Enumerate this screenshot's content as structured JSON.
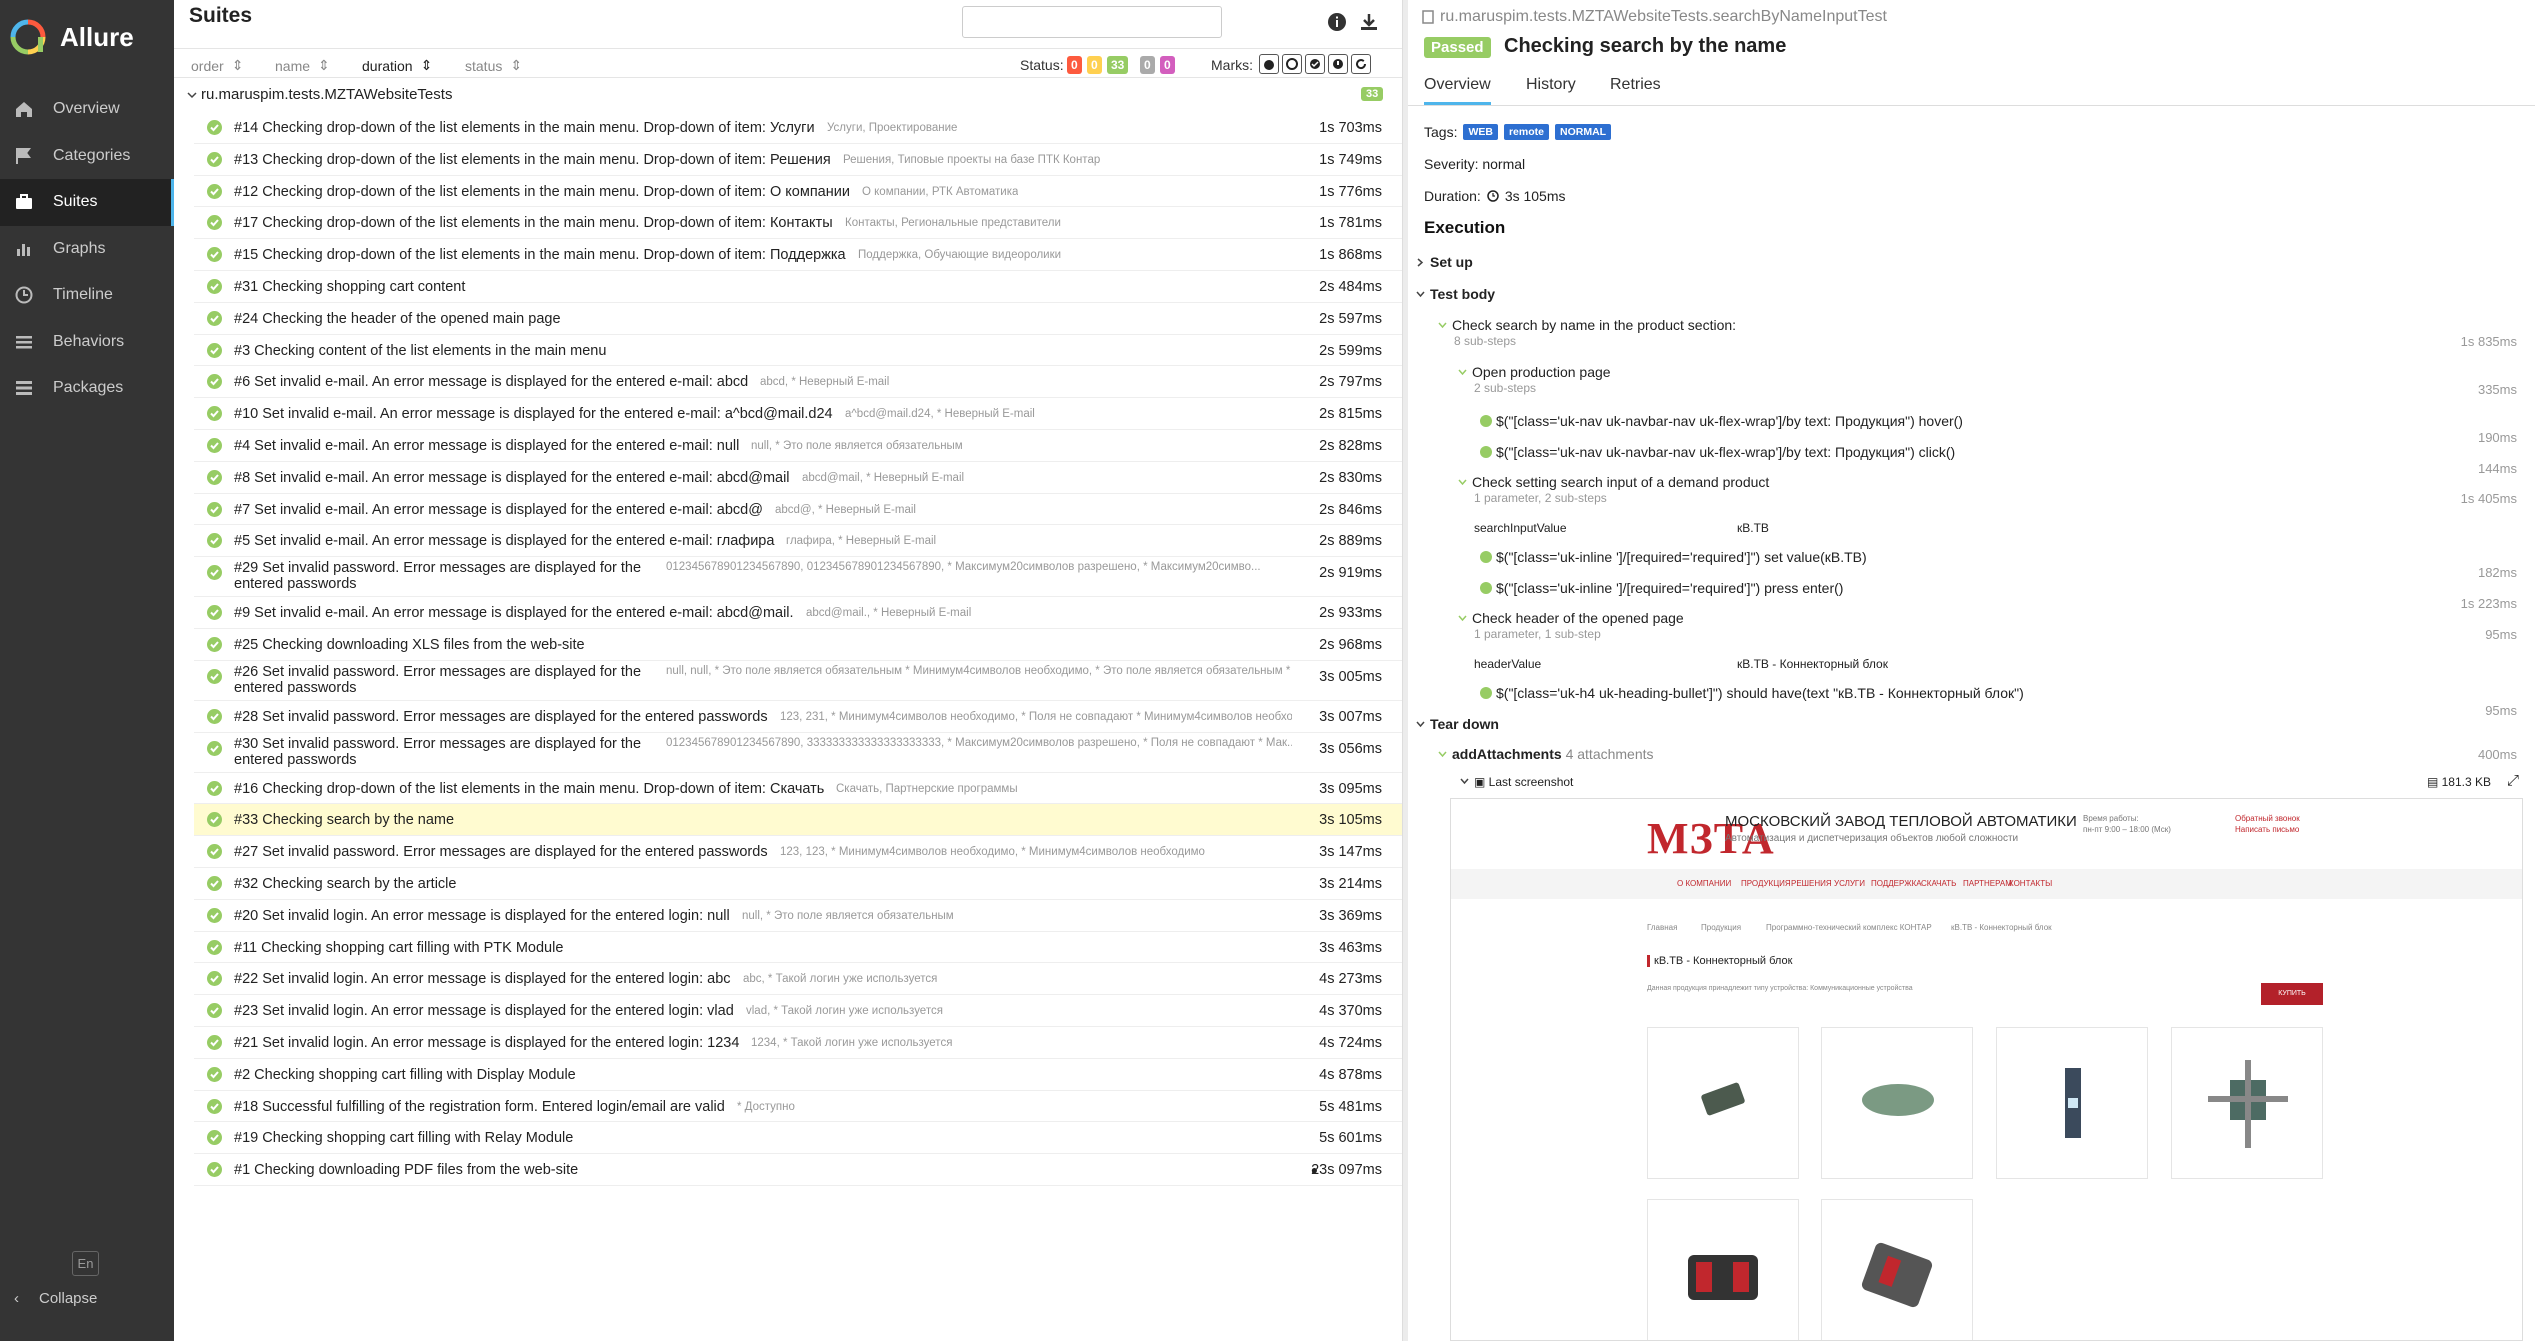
{
  "app": {
    "name": "Allure"
  },
  "sidebar": {
    "items": [
      {
        "label": "Overview",
        "icon": "home-icon"
      },
      {
        "label": "Categories",
        "icon": "flag-icon"
      },
      {
        "label": "Suites",
        "icon": "briefcase-icon",
        "active": true
      },
      {
        "label": "Graphs",
        "icon": "bar-chart-icon"
      },
      {
        "label": "Timeline",
        "icon": "clock-icon"
      },
      {
        "label": "Behaviors",
        "icon": "list-icon"
      },
      {
        "label": "Packages",
        "icon": "packages-icon"
      }
    ],
    "lang": "En",
    "collapse": "Collapse"
  },
  "suites": {
    "title": "Suites",
    "search_placeholder": "",
    "sort": {
      "order": "order",
      "name": "name",
      "duration": "duration",
      "status": "status"
    },
    "status_label": "Status:",
    "status_counts": [
      {
        "value": "0",
        "color": "#fd5a3e"
      },
      {
        "value": "0",
        "color": "#ffd050"
      },
      {
        "value": "33",
        "color": "#97cc64"
      },
      {
        "value": "0",
        "color": "#aaaaaa"
      },
      {
        "value": "0",
        "color": "#d35ebe"
      }
    ],
    "marks_label": "Marks:",
    "group": {
      "name": "ru.maruspim.tests.MZTAWebsiteTests",
      "count": "33"
    },
    "tests": [
      {
        "num": "#14",
        "name": "Checking drop-down of the list elements in the main menu. Drop-down of item: Услуги",
        "params": "Услуги, Проектирование",
        "duration": "1s 703ms"
      },
      {
        "num": "#13",
        "name": "Checking drop-down of the list elements in the main menu. Drop-down of item: Решения",
        "params": "Решения, Типовые проекты на базе ПТК Контар",
        "duration": "1s 749ms"
      },
      {
        "num": "#12",
        "name": "Checking drop-down of the list elements in the main menu. Drop-down of item: О компании",
        "params": "О компании, РТК Автоматика",
        "duration": "1s 776ms"
      },
      {
        "num": "#17",
        "name": "Checking drop-down of the list elements in the main menu. Drop-down of item: Контакты",
        "params": "Контакты, Региональные представители",
        "duration": "1s 781ms"
      },
      {
        "num": "#15",
        "name": "Checking drop-down of the list elements in the main menu. Drop-down of item: Поддержка",
        "params": "Поддержка, Обучающие видеоролики",
        "duration": "1s 868ms"
      },
      {
        "num": "#31",
        "name": "Checking shopping cart content",
        "params": "",
        "duration": "2s 484ms"
      },
      {
        "num": "#24",
        "name": "Checking the header of the opened main page",
        "params": "",
        "duration": "2s 597ms"
      },
      {
        "num": "#3",
        "name": "Checking content of the list elements in the main menu",
        "params": "",
        "duration": "2s 599ms"
      },
      {
        "num": "#6",
        "name": "Set invalid e-mail. An error message is displayed for the entered e-mail: abcd",
        "params": "abcd, * Неверный E-mail",
        "duration": "2s 797ms"
      },
      {
        "num": "#10",
        "name": "Set invalid e-mail. An error message is displayed for the entered e-mail: a^bcd@mail.d24",
        "params": "a^bcd@mail.d24, * Неверный E-mail",
        "duration": "2s 815ms"
      },
      {
        "num": "#4",
        "name": "Set invalid e-mail. An error message is displayed for the entered e-mail: null",
        "params": "null, * Это поле является обязательным",
        "duration": "2s 828ms"
      },
      {
        "num": "#8",
        "name": "Set invalid e-mail. An error message is displayed for the entered e-mail: abcd@mail",
        "params": "abcd@mail, * Неверный E-mail",
        "duration": "2s 830ms"
      },
      {
        "num": "#7",
        "name": "Set invalid e-mail. An error message is displayed for the entered e-mail: abcd@",
        "params": "abcd@, * Неверный E-mail",
        "duration": "2s 846ms"
      },
      {
        "num": "#5",
        "name": "Set invalid e-mail. An error message is displayed for the entered e-mail: глафира",
        "params": "глафира, * Неверный E-mail",
        "duration": "2s 889ms"
      },
      {
        "num": "#29",
        "name": "Set invalid password. Error messages are displayed for the entered passwords",
        "params": "01234567890123456789​0, 01234567890123456789​0, * Максимум20символов разрешено, * Максимум20симво...",
        "duration": "2s 919ms",
        "two": true
      },
      {
        "num": "#9",
        "name": "Set invalid e-mail. An error message is displayed for the entered e-mail: abcd@mail.",
        "params": "abcd@mail., * Неверный E-mail",
        "duration": "2s 933ms"
      },
      {
        "num": "#25",
        "name": "Checking downloading XLS files from the web-site",
        "params": "",
        "duration": "2s 968ms"
      },
      {
        "num": "#26",
        "name": "Set invalid password. Error messages are displayed for the entered passwords",
        "params": "null, null, * Это поле является обязательным * Минимум4символов необходимо, * Это поле является обязательным * ...",
        "duration": "3s 005ms",
        "two": true
      },
      {
        "num": "#28",
        "name": "Set invalid password. Error messages are displayed for the entered passwords",
        "params": "123, 231, * Минимум4символов необходимо, * Поля не совпадают * Минимум4символов необходимо",
        "duration": "3s 007ms"
      },
      {
        "num": "#30",
        "name": "Set invalid password. Error messages are displayed for the entered passwords",
        "params": "01234567890123456789​0, 3333333333333333333​33, * Максимум20символов разрешено, * Поля не совпадают * Мак...",
        "duration": "3s 056ms",
        "two": true
      },
      {
        "num": "#16",
        "name": "Checking drop-down of the list elements in the main menu. Drop-down of item: Скачать",
        "params": "Скачать, Партнерские программы",
        "duration": "3s 095ms"
      },
      {
        "num": "#33",
        "name": "Checking search by the name",
        "params": "",
        "duration": "3s 105ms",
        "selected": true
      },
      {
        "num": "#27",
        "name": "Set invalid password. Error messages are displayed for the entered passwords",
        "params": "123, 123, * Минимум4символов необходимо, * Минимум4символов необходимо",
        "duration": "3s 147ms"
      },
      {
        "num": "#32",
        "name": "Checking search by the article",
        "params": "",
        "duration": "3s 214ms"
      },
      {
        "num": "#20",
        "name": "Set invalid login. An error message is displayed for the entered login: null",
        "params": "null, * Это поле является обязательным",
        "duration": "3s 369ms"
      },
      {
        "num": "#11",
        "name": "Checking shopping cart filling with PTK Module",
        "params": "",
        "duration": "3s 463ms"
      },
      {
        "num": "#22",
        "name": "Set invalid login. An error message is displayed for the entered login: abc",
        "params": "abc, * Такой логин уже используется",
        "duration": "4s 273ms"
      },
      {
        "num": "#23",
        "name": "Set invalid login. An error message is displayed for the entered login: vlad",
        "params": "vlad, * Такой логин уже используется",
        "duration": "4s 370ms"
      },
      {
        "num": "#21",
        "name": "Set invalid login. An error message is displayed for the entered login: 1234",
        "params": "1234, * Такой логин уже используется",
        "duration": "4s 724ms"
      },
      {
        "num": "#2",
        "name": "Checking shopping cart filling with Display Module",
        "params": "",
        "duration": "4s 878ms"
      },
      {
        "num": "#18",
        "name": "Successful fulfilling of the registration form. Entered login/email are valid",
        "params": "* Доступно",
        "duration": "5s 481ms"
      },
      {
        "num": "#19",
        "name": "Checking shopping cart filling with Relay Module",
        "params": "",
        "duration": "5s 601ms"
      },
      {
        "num": "#1",
        "name": "Checking downloading PDF files from the web-site",
        "params": "",
        "duration": "23s 097ms",
        "marked": true
      }
    ]
  },
  "detail": {
    "path": "ru.maruspim.tests.MZTAWebsiteTests.searchByNameInputTest",
    "status": "Passed",
    "title": "Checking search by the name",
    "tabs": [
      "Overview",
      "History",
      "Retries"
    ],
    "tags_label": "Tags:",
    "tags": [
      "WEB",
      "remote",
      "NORMAL"
    ],
    "severity": "Severity: normal",
    "duration_label": "Duration:",
    "duration": "3s 105ms",
    "execution": "Execution",
    "setup": "Set up",
    "test_body": "Test body",
    "s1": {
      "title": "Check search by name in the product section:",
      "sub": "8 sub-steps",
      "dur": "1s 835ms"
    },
    "s1a": {
      "title": "Open production page",
      "sub": "2 sub-steps",
      "dur": "335ms"
    },
    "s1a1": {
      "title": "$(\"[class='uk-nav uk-navbar-nav uk-flex-wrap']/by text: Продукция\") hover()",
      "dur": "190ms"
    },
    "s1a2": {
      "title": "$(\"[class='uk-nav uk-navbar-nav uk-flex-wrap']/by text: Продукция\") click()",
      "dur": "144ms"
    },
    "s1b": {
      "title": "Check setting search input of a demand product",
      "sub": "1 parameter, 2 sub-steps",
      "dur": "1s 405ms",
      "pkey": "searchInputValue",
      "pval": "кВ.ТВ"
    },
    "s1b1": {
      "title": "$(\"[class='uk-inline ']/[required='required']\") set value(кВ.ТВ)",
      "dur": "182ms"
    },
    "s1b2": {
      "title": "$(\"[class='uk-inline ']/[required='required']\") press enter()",
      "dur": "1s 223ms"
    },
    "s1c": {
      "title": "Check header of the opened page",
      "sub": "1 parameter, 1 sub-step",
      "dur": "95ms",
      "pkey": "headerValue",
      "pval": "кВ.ТВ - Коннекторный блок"
    },
    "s1c1": {
      "title": "$(\"[class='uk-h4 uk-heading-bullet']\") should have(text \"кВ.ТВ - Коннекторный блок\")",
      "dur": "95ms"
    },
    "teardown": "Tear down",
    "attach": {
      "title": "addAttachments",
      "count": "4 attachments",
      "dur": "400ms"
    },
    "screenshot": {
      "label": "Last screenshot",
      "size": "181.3 KB"
    }
  },
  "site": {
    "brand": "МЗТА",
    "title": "МОСКОВСКИЙ ЗАВОД ТЕПЛОВОЙ АВТОМАТИКИ",
    "subtitle": "Автоматизация и диспетчеризация объектов любой сложности",
    "hours": "Время работы:\nпн-пт 9:00 – 18:00 (Мск)",
    "contact": "Обратный звонок\nНаписать письмо",
    "menu": [
      "О КОМПАНИИ",
      "ПРОДУКЦИЯ",
      "РЕШЕНИЯ",
      "УСЛУГИ",
      "ПОДДЕРЖКА",
      "СКАЧАТЬ",
      "ПАРТНЕРАМ",
      "КОНТАКТЫ"
    ],
    "crumbs": [
      "Главная",
      "Продукция",
      "Программно-технический комплекс КОНТАР",
      "кВ.ТВ - Коннекторный блок"
    ],
    "heading": "кВ.ТВ - Коннекторный блок",
    "para": "Данная продукция принадлежит типу устройства: Коммуникационные устройства",
    "buy": "КУПИТЬ"
  }
}
